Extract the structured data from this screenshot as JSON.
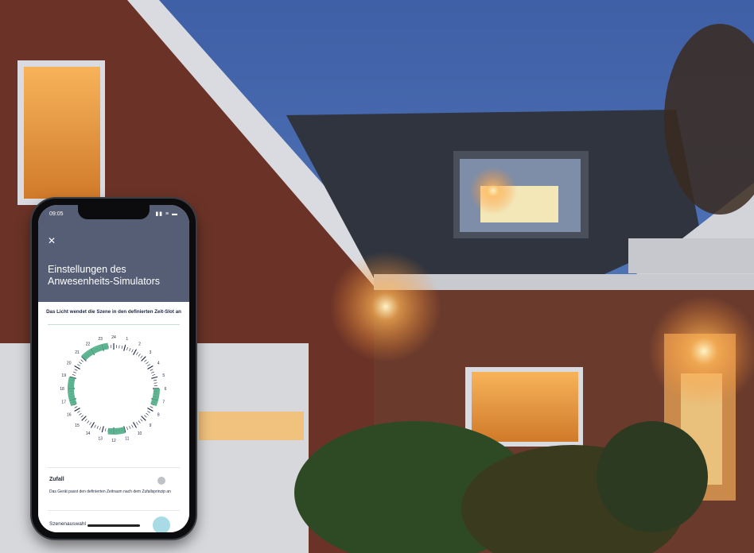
{
  "phone": {
    "status_time": "09:05",
    "status_icons": "▮▮ ≡ ▬",
    "close_icon": "✕",
    "title": "Einstellungen des Anwesenheits-Simulators",
    "caption": "Das Licht wendet die Szene in den definierten Zeit-Slot an",
    "dial": {
      "hours": [
        24,
        1,
        2,
        3,
        4,
        5,
        6,
        7,
        8,
        9,
        10,
        11,
        12,
        13,
        14,
        15,
        16,
        17,
        18,
        19,
        20,
        21,
        22,
        23
      ],
      "active_slots": [
        [
          16.5,
          19.0
        ],
        [
          21.0,
          23.5
        ],
        [
          11.0,
          12.5
        ],
        [
          6.0,
          7.5
        ]
      ],
      "accent_color": "#4fae86"
    },
    "zufall_label": "Zufall",
    "zufall_enabled": false,
    "zufall_description": "Das Gerät passt den definierten Zeitraum nach dem Zufallsprinzip an",
    "bottom_label": "Szenenauswahl"
  }
}
